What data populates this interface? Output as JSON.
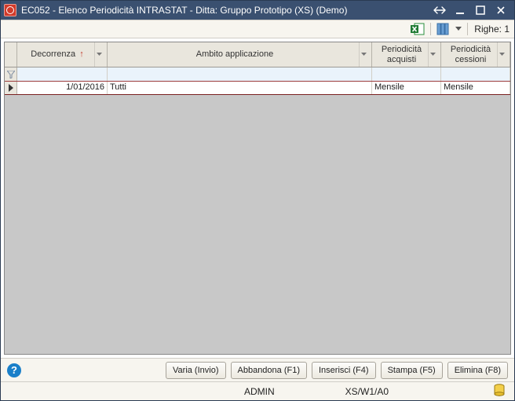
{
  "window": {
    "title": "EC052 - Elenco Periodicità INTRASTAT - Ditta: Gruppo Prototipo (XS)  (Demo)"
  },
  "toolbar": {
    "rows_label": "Righe:",
    "rows_count": "1"
  },
  "grid": {
    "columns": {
      "decorrenza": "Decorrenza",
      "ambito": "Ambito applicazione",
      "periodicita_acquisti": "Periodicità acquisti",
      "periodicita_cessioni": "Periodicità cessioni"
    },
    "rows": [
      {
        "decorrenza": "1/01/2016",
        "ambito": "Tutti",
        "periodicita_acquisti": "Mensile",
        "periodicita_cessioni": "Mensile"
      }
    ]
  },
  "buttons": {
    "varia": "Varia (Invio)",
    "abbandona": "Abbandona (F1)",
    "inserisci": "Inserisci (F4)",
    "stampa": "Stampa (F5)",
    "elimina": "Elimina (F8)"
  },
  "status": {
    "user": "ADMIN",
    "path": "XS/W1/A0"
  }
}
